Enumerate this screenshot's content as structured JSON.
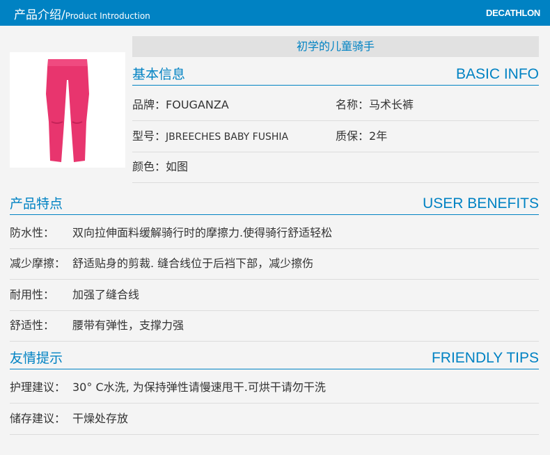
{
  "header": {
    "title_cn": "产品介绍/",
    "title_en": "Product Introduction",
    "logo": "DECATHLON"
  },
  "product": {
    "title": "初学的儿童骑手",
    "image_label": "pink-riding-breeches",
    "color_accent": "#0082c3",
    "pants_color": "#e8356e"
  },
  "basic_info": {
    "heading_cn": "基本信息",
    "heading_en": "BASIC INFO",
    "brand_label": "品牌：",
    "brand_value": "FOUGANZA",
    "name_label": "名称：",
    "name_value": "马术长裤",
    "model_label": "型号：",
    "model_value": "JBREECHES BABY FUSHIA",
    "warranty_label": "质保：",
    "warranty_value": "2年",
    "color_label": "颜色：",
    "color_value": "如图"
  },
  "benefits": {
    "heading_cn": "产品特点",
    "heading_en": "USER BENEFITS",
    "items": [
      {
        "label": "防水性：",
        "text": "双向拉伸面料缓解骑行时的摩擦力.使得骑行舒适轻松"
      },
      {
        "label": "减少摩擦：",
        "text": "舒适贴身的剪裁. 缝合线位于后裆下部，减少擦伤"
      },
      {
        "label": "耐用性：",
        "text": "加强了缝合线"
      },
      {
        "label": "舒适性：",
        "text": "腰带有弹性，支撑力强"
      }
    ]
  },
  "tips": {
    "heading_cn": "友情提示",
    "heading_en": "FRIENDLY TIPS",
    "items": [
      {
        "label": "护理建议：",
        "text": "30° C水洗, 为保持弹性请慢速甩干.可烘干请勿干洗"
      },
      {
        "label": "储存建议：",
        "text": "干燥处存放"
      }
    ]
  }
}
